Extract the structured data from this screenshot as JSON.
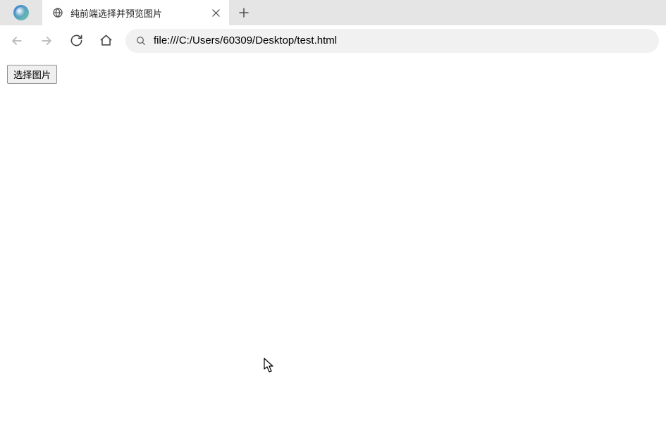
{
  "tab": {
    "title": "纯前端选择并预览图片"
  },
  "address": {
    "url": "file:///C:/Users/60309/Desktop/test.html"
  },
  "page": {
    "choose_label": "选择图片"
  }
}
